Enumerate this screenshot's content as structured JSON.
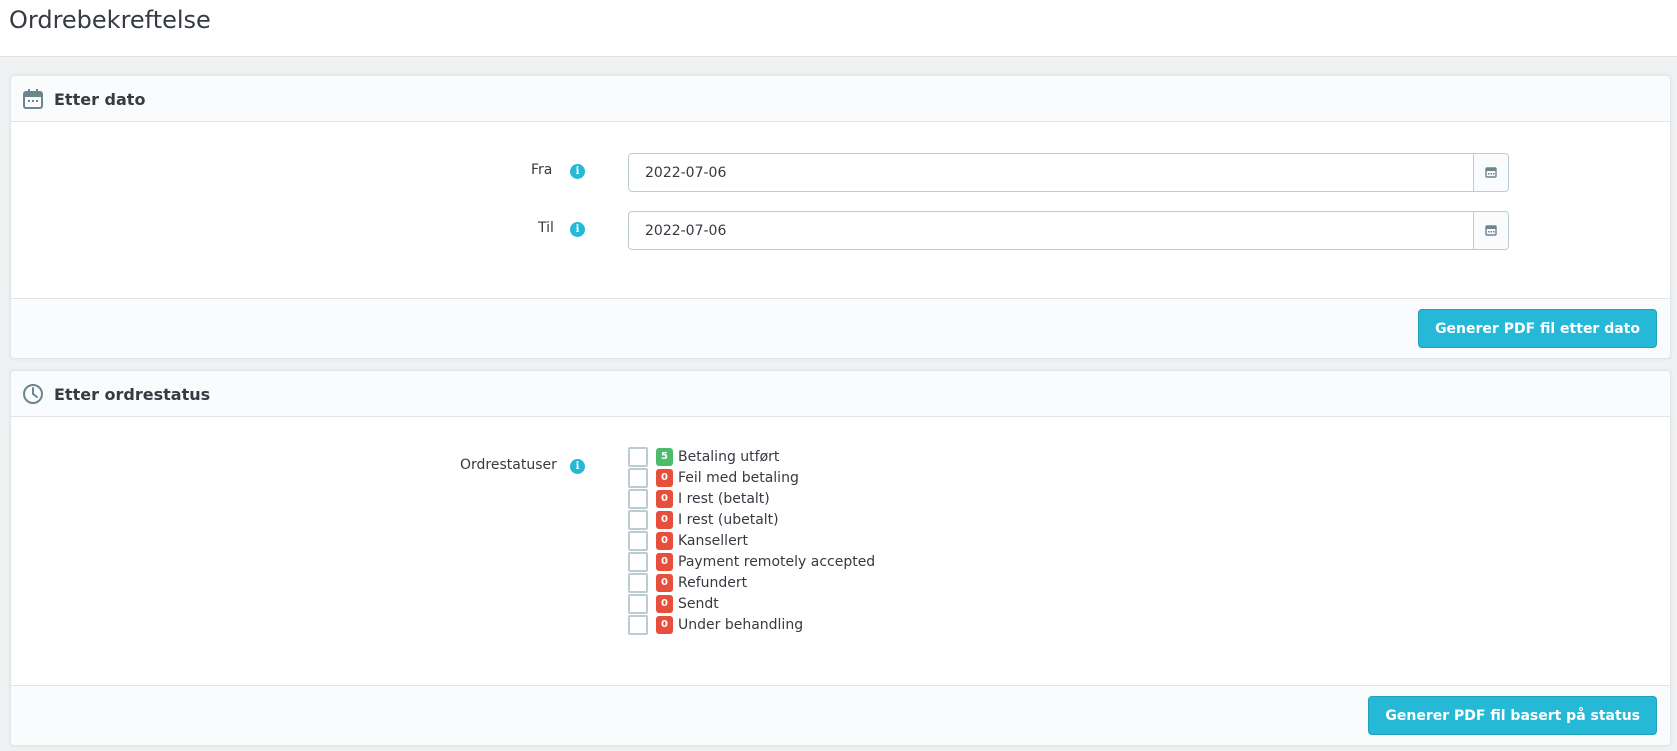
{
  "page": {
    "title": "Ordrebekreftelse"
  },
  "colors": {
    "accent": "#25b9d7",
    "badge_success": "#4cbb6c",
    "badge_danger": "#e84e3c"
  },
  "date_panel": {
    "icon": "calendar-icon",
    "title": "Etter dato",
    "from_label": "Fra",
    "from_value": "2022-07-06",
    "to_label": "Til",
    "to_value": "2022-07-06",
    "submit_label": "Generer PDF fil etter dato"
  },
  "status_panel": {
    "icon": "clock-icon",
    "title": "Etter ordrestatus",
    "field_label": "Ordrestatuser",
    "statuses": [
      {
        "count": "5",
        "label": "Betaling utført",
        "color": "#4cbb6c"
      },
      {
        "count": "0",
        "label": "Feil med betaling",
        "color": "#e84e3c"
      },
      {
        "count": "0",
        "label": "I rest (betalt)",
        "color": "#e84e3c"
      },
      {
        "count": "0",
        "label": "I rest (ubetalt)",
        "color": "#e84e3c"
      },
      {
        "count": "0",
        "label": "Kansellert",
        "color": "#e84e3c"
      },
      {
        "count": "0",
        "label": "Payment remotely accepted",
        "color": "#e84e3c"
      },
      {
        "count": "0",
        "label": "Refundert",
        "color": "#e84e3c"
      },
      {
        "count": "0",
        "label": "Sendt",
        "color": "#e84e3c"
      },
      {
        "count": "0",
        "label": "Under behandling",
        "color": "#e84e3c"
      }
    ],
    "submit_label": "Generer PDF fil basert på status"
  }
}
